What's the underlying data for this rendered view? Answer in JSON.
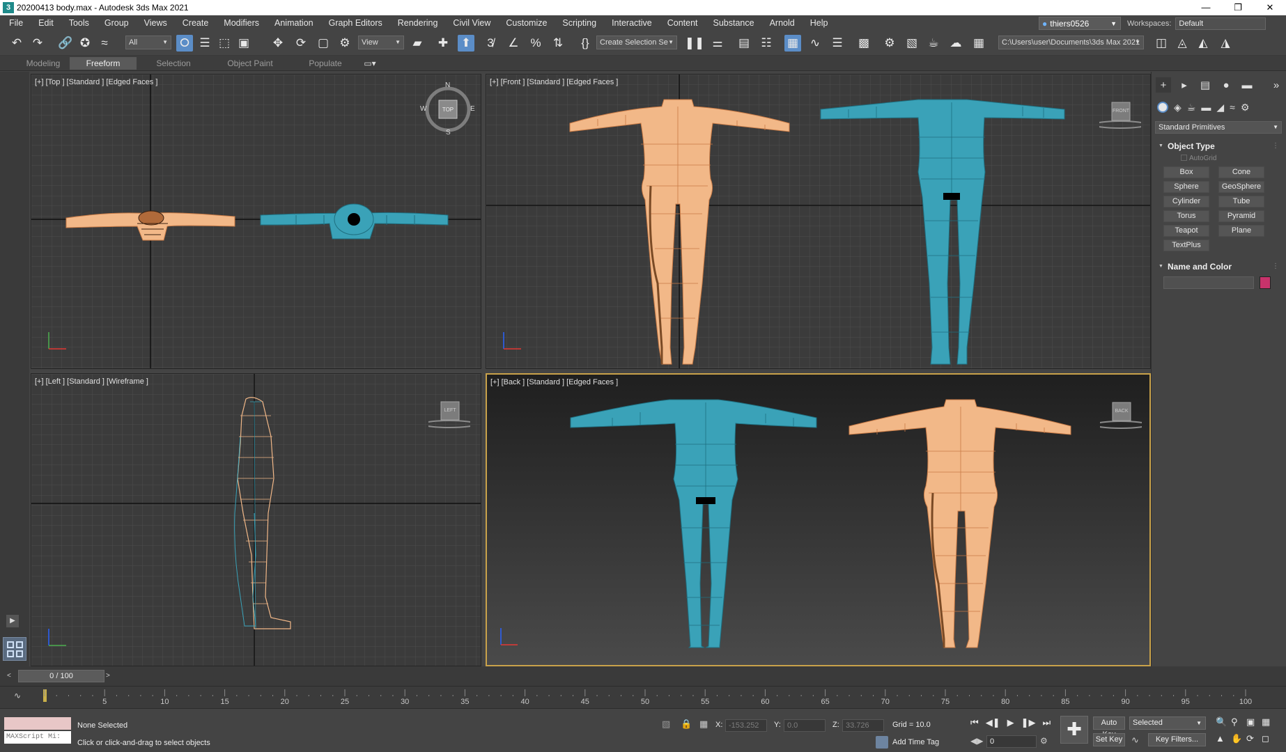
{
  "window": {
    "title": "20200413 body.max - Autodesk 3ds Max 2021",
    "app_icon": "3",
    "controls": [
      "minimize-icon",
      "restore-icon",
      "close-icon"
    ]
  },
  "menu": [
    "File",
    "Edit",
    "Tools",
    "Group",
    "Views",
    "Create",
    "Modifiers",
    "Animation",
    "Graph Editors",
    "Rendering",
    "Civil View",
    "Customize",
    "Scripting",
    "Interactive",
    "Content",
    "Substance",
    "Arnold",
    "Help"
  ],
  "user": {
    "name": "thiers0526"
  },
  "workspaces": {
    "label": "Workspaces:",
    "value": "Default"
  },
  "toolbar": {
    "filter_value": "All",
    "ref_coord_value": "View",
    "selection_set_value": "Create Selection Se",
    "project_path": "C:\\Users\\user\\Documents\\3ds Max 2021"
  },
  "ribbon_tabs": [
    "Modeling",
    "Freeform",
    "Selection",
    "Object Paint",
    "Populate"
  ],
  "ribbon_active": "Freeform",
  "viewports": {
    "top": {
      "label": "[+] [Top ] [Standard ] [Edged Faces ]",
      "compass": {
        "n": "N",
        "s": "S",
        "e": "E",
        "w": "W",
        "cube": "TOP"
      }
    },
    "front": {
      "label": "[+] [Front ] [Standard ] [Edged Faces ]",
      "cube": "FRONT"
    },
    "left": {
      "label": "[+] [Left ] [Standard ] [Wireframe ]",
      "cube": "LEFT"
    },
    "back": {
      "label": "[+] [Back ] [Standard ] [Edged Faces ]",
      "cube": "BACK"
    }
  },
  "colors": {
    "skin": "#f2b888",
    "skin_edge": "#c87a45",
    "teal": "#3aa2b8",
    "teal_edge": "#1f6f80",
    "active_border": "#c9a24a",
    "name_color_swatch": "#c8336b",
    "grid_bg": "#3b3b3b",
    "active_button": "#5b8dc7"
  },
  "command_panel": {
    "dropdown": "Standard Primitives",
    "object_type": {
      "title": "Object Type",
      "autogrid": "AutoGrid",
      "buttons": [
        "Box",
        "Cone",
        "Sphere",
        "GeoSphere",
        "Cylinder",
        "Tube",
        "Torus",
        "Pyramid",
        "Teapot",
        "Plane",
        "TextPlus"
      ]
    },
    "name_and_color": {
      "title": "Name and Color",
      "value": ""
    }
  },
  "timeline": {
    "frame_display": "0 / 100",
    "ticks": [
      "5",
      "10",
      "15",
      "20",
      "25",
      "30",
      "35",
      "40",
      "45",
      "50",
      "55",
      "60",
      "65",
      "70",
      "75",
      "80",
      "85",
      "90",
      "95",
      "100"
    ]
  },
  "status": {
    "maxscript": "MAXScript Mi:",
    "selection": "None Selected",
    "prompt": "Click or click-and-drag to select objects",
    "x_label": "X:",
    "x_value": "-153.252",
    "y_label": "Y:",
    "y_value": "0.0",
    "z_label": "Z:",
    "z_value": "33.726",
    "grid": "Grid = 10.0",
    "add_time_tag": "Add Time Tag",
    "auto_key": "Auto Key",
    "set_key": "Set Key",
    "key_mode_value": "Selected",
    "key_filters": "Key Filters...",
    "current_frame": "0"
  }
}
